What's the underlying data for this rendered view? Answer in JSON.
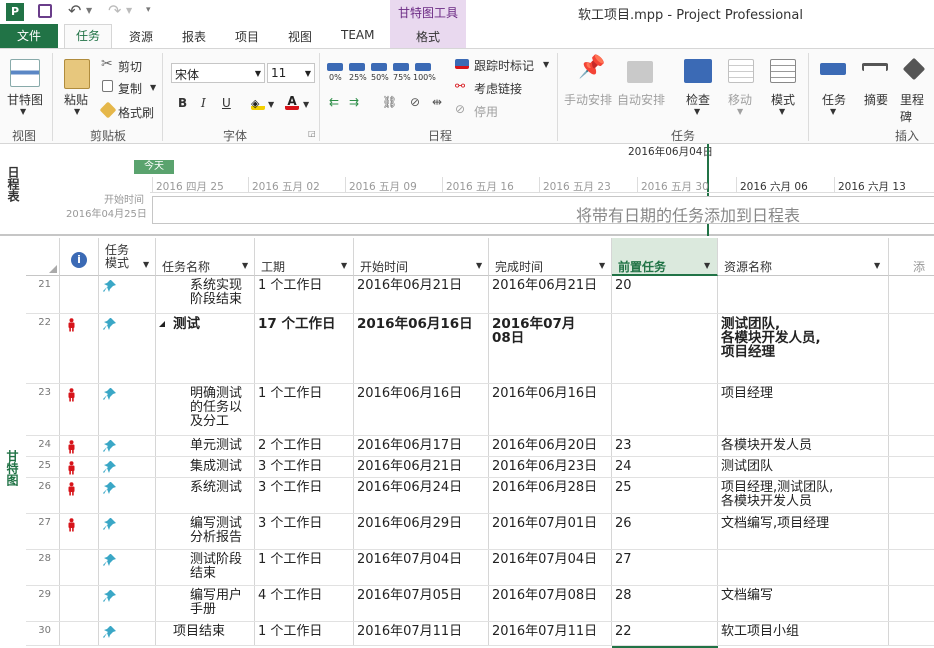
{
  "window": {
    "title": "软工项目.mpp - Project Professional",
    "context_tab_group": "甘特图工具"
  },
  "tabs": {
    "file": "文件",
    "items": [
      "任务",
      "资源",
      "报表",
      "项目",
      "视图",
      "TEAM",
      "格式"
    ],
    "active": "任务"
  },
  "ribbon": {
    "view_group": {
      "label": "视图",
      "gantt_button": "甘特图"
    },
    "clipboard_group": {
      "label": "剪贴板",
      "paste": "粘贴",
      "cut": "剪切",
      "copy": "复制",
      "format_painter": "格式刷"
    },
    "font_group": {
      "label": "字体",
      "font_name": "宋体",
      "font_size": "11",
      "bold": "B",
      "italic": "I",
      "underline": "U"
    },
    "schedule_group": {
      "label": "日程",
      "percent_labels": [
        "0%",
        "25%",
        "50%",
        "75%",
        "100%"
      ],
      "track": "跟踪时标记",
      "respect_links": "考虑链接",
      "inactivate": "停用"
    },
    "tasks_group": {
      "label": "任务",
      "manual": "手动安排",
      "auto": "自动安排",
      "inspect": "检查",
      "move": "移动",
      "mode": "模式"
    },
    "insert_group": {
      "label": "插入",
      "task": "任务",
      "summary": "摘要",
      "milestone": "里程碑"
    }
  },
  "timeline": {
    "vertical_label": "日程表",
    "today_marker": "今天",
    "current_date": "2016年06月04日",
    "start_label": "开始时间",
    "start_date": "2016年04月25日",
    "dates": [
      "2016 四月 25",
      "2016 五月 02",
      "2016 五月 09",
      "2016 五月 16",
      "2016 五月 23",
      "2016 五月 30",
      "2016 六月 06",
      "2016 六月 13"
    ],
    "placeholder": "将带有日期的任务添加到日程表"
  },
  "side_label": "甘特图",
  "table": {
    "headers": {
      "info": "ⓘ",
      "mode": "任务\n模式",
      "name": "任务名称",
      "duration": "工期",
      "start": "开始时间",
      "finish": "完成时间",
      "predecessors": "前置任务",
      "resources": "资源名称",
      "extra": "添"
    },
    "rows": [
      {
        "id": "21",
        "name": "系统实现\n阶段结束",
        "duration": "1 个工作日",
        "start": "2016年06月21日",
        "finish": "2016年06月21日",
        "pred": "20",
        "res": "",
        "person": false,
        "summary": false
      },
      {
        "id": "22",
        "name": "测试",
        "duration": "17 个工作日",
        "start": "2016年06月16日",
        "finish": "2016年07月\n08日",
        "pred": "",
        "res": "测试团队,\n各模块开发人员,\n项目经理",
        "person": true,
        "summary": true
      },
      {
        "id": "23",
        "name": "明确测试\n的任务以\n及分工",
        "duration": "1 个工作日",
        "start": "2016年06月16日",
        "finish": "2016年06月16日",
        "pred": "",
        "res": "项目经理",
        "person": true,
        "summary": false
      },
      {
        "id": "24",
        "name": "单元测试",
        "duration": "2 个工作日",
        "start": "2016年06月17日",
        "finish": "2016年06月20日",
        "pred": "23",
        "res": "各模块开发人员",
        "person": true,
        "summary": false
      },
      {
        "id": "25",
        "name": "集成测试",
        "duration": "3 个工作日",
        "start": "2016年06月21日",
        "finish": "2016年06月23日",
        "pred": "24",
        "res": "测试团队",
        "person": true,
        "summary": false
      },
      {
        "id": "26",
        "name": "系统测试",
        "duration": "3 个工作日",
        "start": "2016年06月24日",
        "finish": "2016年06月28日",
        "pred": "25",
        "res": "项目经理,测试团队,\n各模块开发人员",
        "person": true,
        "summary": false
      },
      {
        "id": "27",
        "name": "编写测试\n分析报告",
        "duration": "3 个工作日",
        "start": "2016年06月29日",
        "finish": "2016年07月01日",
        "pred": "26",
        "res": "文档编写,项目经理",
        "person": true,
        "summary": false
      },
      {
        "id": "28",
        "name": "测试阶段\n结束",
        "duration": "1 个工作日",
        "start": "2016年07月04日",
        "finish": "2016年07月04日",
        "pred": "27",
        "res": "",
        "person": false,
        "summary": false
      },
      {
        "id": "29",
        "name": "编写用户\n手册",
        "duration": "4 个工作日",
        "start": "2016年07月05日",
        "finish": "2016年07月08日",
        "pred": "28",
        "res": "文档编写",
        "person": false,
        "summary": false
      },
      {
        "id": "30",
        "name": "项目结束",
        "duration": "1 个工作日",
        "start": "2016年07月11日",
        "finish": "2016年07月11日",
        "pred": "22",
        "res": "软工项目小组",
        "person": false,
        "summary": false,
        "outdent": true
      }
    ]
  },
  "colors": {
    "accent_green": "#217346",
    "context_purple": "#e9d9ef",
    "person_red": "#d7141a",
    "pin_teal": "#3aa7c6"
  }
}
